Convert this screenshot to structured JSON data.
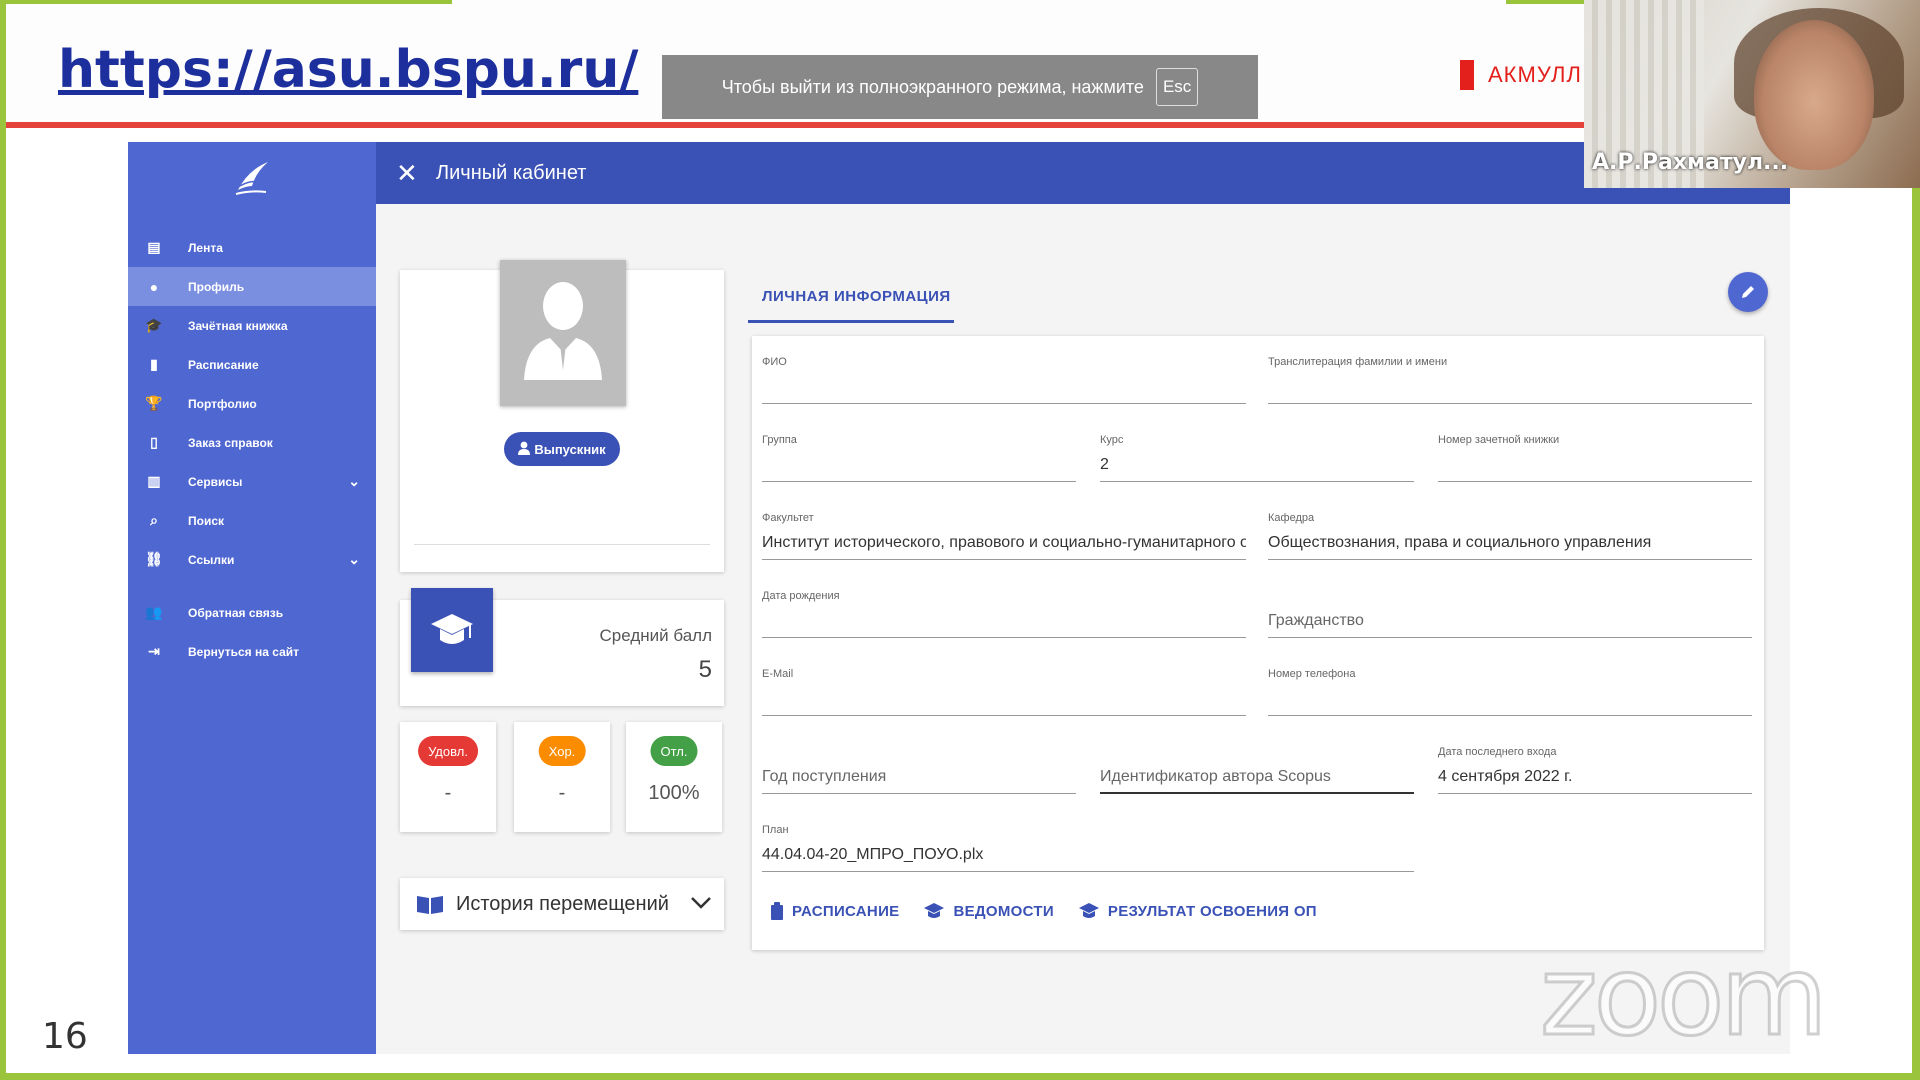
{
  "slide": {
    "url": "https://asu.bspu.ru/",
    "page_number": "16",
    "brand": "АКМУЛЛ",
    "watermark": "zoom"
  },
  "fullscreen_notice": {
    "text": "Чтобы выйти из полноэкранного режима, нажмите",
    "key": "Esc"
  },
  "video": {
    "participant_name": "А.Р.Рахматул..."
  },
  "app": {
    "title": "Личный кабинет",
    "close_glyph": "✕"
  },
  "sidebar": {
    "items": [
      {
        "label": "Лента",
        "icon": "feed-icon",
        "glyph": "▤"
      },
      {
        "label": "Профиль",
        "icon": "person-icon",
        "glyph": "●",
        "active": true
      },
      {
        "label": "Зачётная книжка",
        "icon": "graduation-cap-icon",
        "glyph": "🎓"
      },
      {
        "label": "Расписание",
        "icon": "clipboard-icon",
        "glyph": "▮"
      },
      {
        "label": "Портфолио",
        "icon": "trophy-icon",
        "glyph": "🏆"
      },
      {
        "label": "Заказ справок",
        "icon": "document-icon",
        "glyph": "▯"
      },
      {
        "label": "Сервисы",
        "icon": "book-icon",
        "glyph": "▥",
        "expandable": true
      },
      {
        "label": "Поиск",
        "icon": "search-icon",
        "glyph": "⌕"
      },
      {
        "label": "Ссылки",
        "icon": "link-icon",
        "glyph": "⛓",
        "expandable": true
      },
      {
        "label": "Обратная связь",
        "icon": "users-icon",
        "glyph": "👥"
      },
      {
        "label": "Вернуться на сайт",
        "icon": "sign-out-icon",
        "glyph": "⇥"
      }
    ],
    "chevron_glyph": "⌄"
  },
  "profile": {
    "status_badge": "Выпускник",
    "gpa_label": "Средний балл",
    "gpa_value": "5",
    "grades": [
      {
        "label": "Удовл.",
        "value": "-",
        "color": "#e53935"
      },
      {
        "label": "Хор.",
        "value": "-",
        "color": "#fb8c00"
      },
      {
        "label": "Отл.",
        "value": "100%",
        "color": "#43a047"
      }
    ],
    "history_label": "История перемещений"
  },
  "info": {
    "tab": "ЛИЧНАЯ ИНФОРМАЦИЯ",
    "fields": {
      "fio": {
        "label": "ФИО",
        "value": ""
      },
      "translit": {
        "label": "Транслитерация фамилии и имени",
        "value": ""
      },
      "group": {
        "label": "Группа",
        "value": ""
      },
      "course": {
        "label": "Курс",
        "value": "2"
      },
      "record_book": {
        "label": "Номер зачетной книжки",
        "value": ""
      },
      "faculty": {
        "label": "Факультет",
        "value": "Институт исторического, правового и социально-гуманитарного об"
      },
      "department": {
        "label": "Кафедра",
        "value": "Обществознания, права и социального управления"
      },
      "birth_date": {
        "label": "Дата рождения",
        "value": ""
      },
      "citizenship": {
        "placeholder": "Гражданство"
      },
      "email": {
        "label": "E-Mail",
        "value": ""
      },
      "phone": {
        "label": "Номер телефона",
        "value": ""
      },
      "admission_year": {
        "placeholder": "Год поступления"
      },
      "scopus": {
        "placeholder": "Идентификатор автора Scopus"
      },
      "last_login": {
        "label": "Дата последнего входа",
        "value": "4 сентября 2022 г."
      },
      "plan": {
        "label": "План",
        "value": "44.04.04-20_МПРО_ПОУО.plx"
      }
    },
    "actions": {
      "schedule": "РАСПИСАНИЕ",
      "statements": "ВЕДОМОСТИ",
      "results": "РЕЗУЛЬТАТ ОСВОЕНИЯ ОП"
    }
  },
  "colors": {
    "primary": "#3a51b5",
    "sidebar": "#4f67d0",
    "sidebar_active": "#7b8fe0",
    "frame_green": "#9ac43c",
    "slide_red": "#e4423b"
  }
}
